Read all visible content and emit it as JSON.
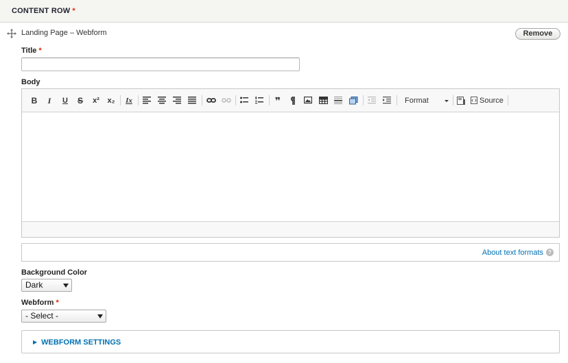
{
  "section": {
    "title": "CONTENT ROW",
    "required_mark": "*"
  },
  "paragraph": {
    "drag_icon": "move-cross-icon",
    "title": "Landing Page – Webform",
    "remove_label": "Remove"
  },
  "title_field": {
    "label": "Title",
    "required_mark": "*",
    "value": ""
  },
  "body_field": {
    "label": "Body",
    "toolbar": {
      "bold": "B",
      "italic": "I",
      "underline": "U",
      "strike": "S",
      "superscript": "x²",
      "subscript": "x₂",
      "remove_format": "Ix",
      "icons": [
        "bold-icon",
        "italic-icon",
        "underline-icon",
        "strikethrough-icon",
        "superscript-icon",
        "subscript-icon",
        "remove-format-icon",
        "align-left-icon",
        "align-center-icon",
        "align-right-icon",
        "align-justify-icon",
        "link-icon",
        "unlink-icon",
        "bulleted-list-icon",
        "numbered-list-icon",
        "blockquote-icon",
        "paragraph-mark-icon",
        "image-icon",
        "table-icon",
        "horizontal-rule-icon",
        "media-icon",
        "outdent-icon",
        "indent-icon",
        "maximize-icon",
        "source-icon"
      ],
      "quote_glyph": "❞",
      "format_label": "Format",
      "source_label": "Source"
    }
  },
  "text_formats": {
    "about_link": "About text formats",
    "help_glyph": "?"
  },
  "background_color": {
    "label": "Background Color",
    "selected": "Dark"
  },
  "webform": {
    "label": "Webform",
    "required_mark": "*",
    "selected": "- Select -"
  },
  "webform_settings": {
    "label": "WEBFORM SETTINGS",
    "toggle_glyph": "▶"
  }
}
